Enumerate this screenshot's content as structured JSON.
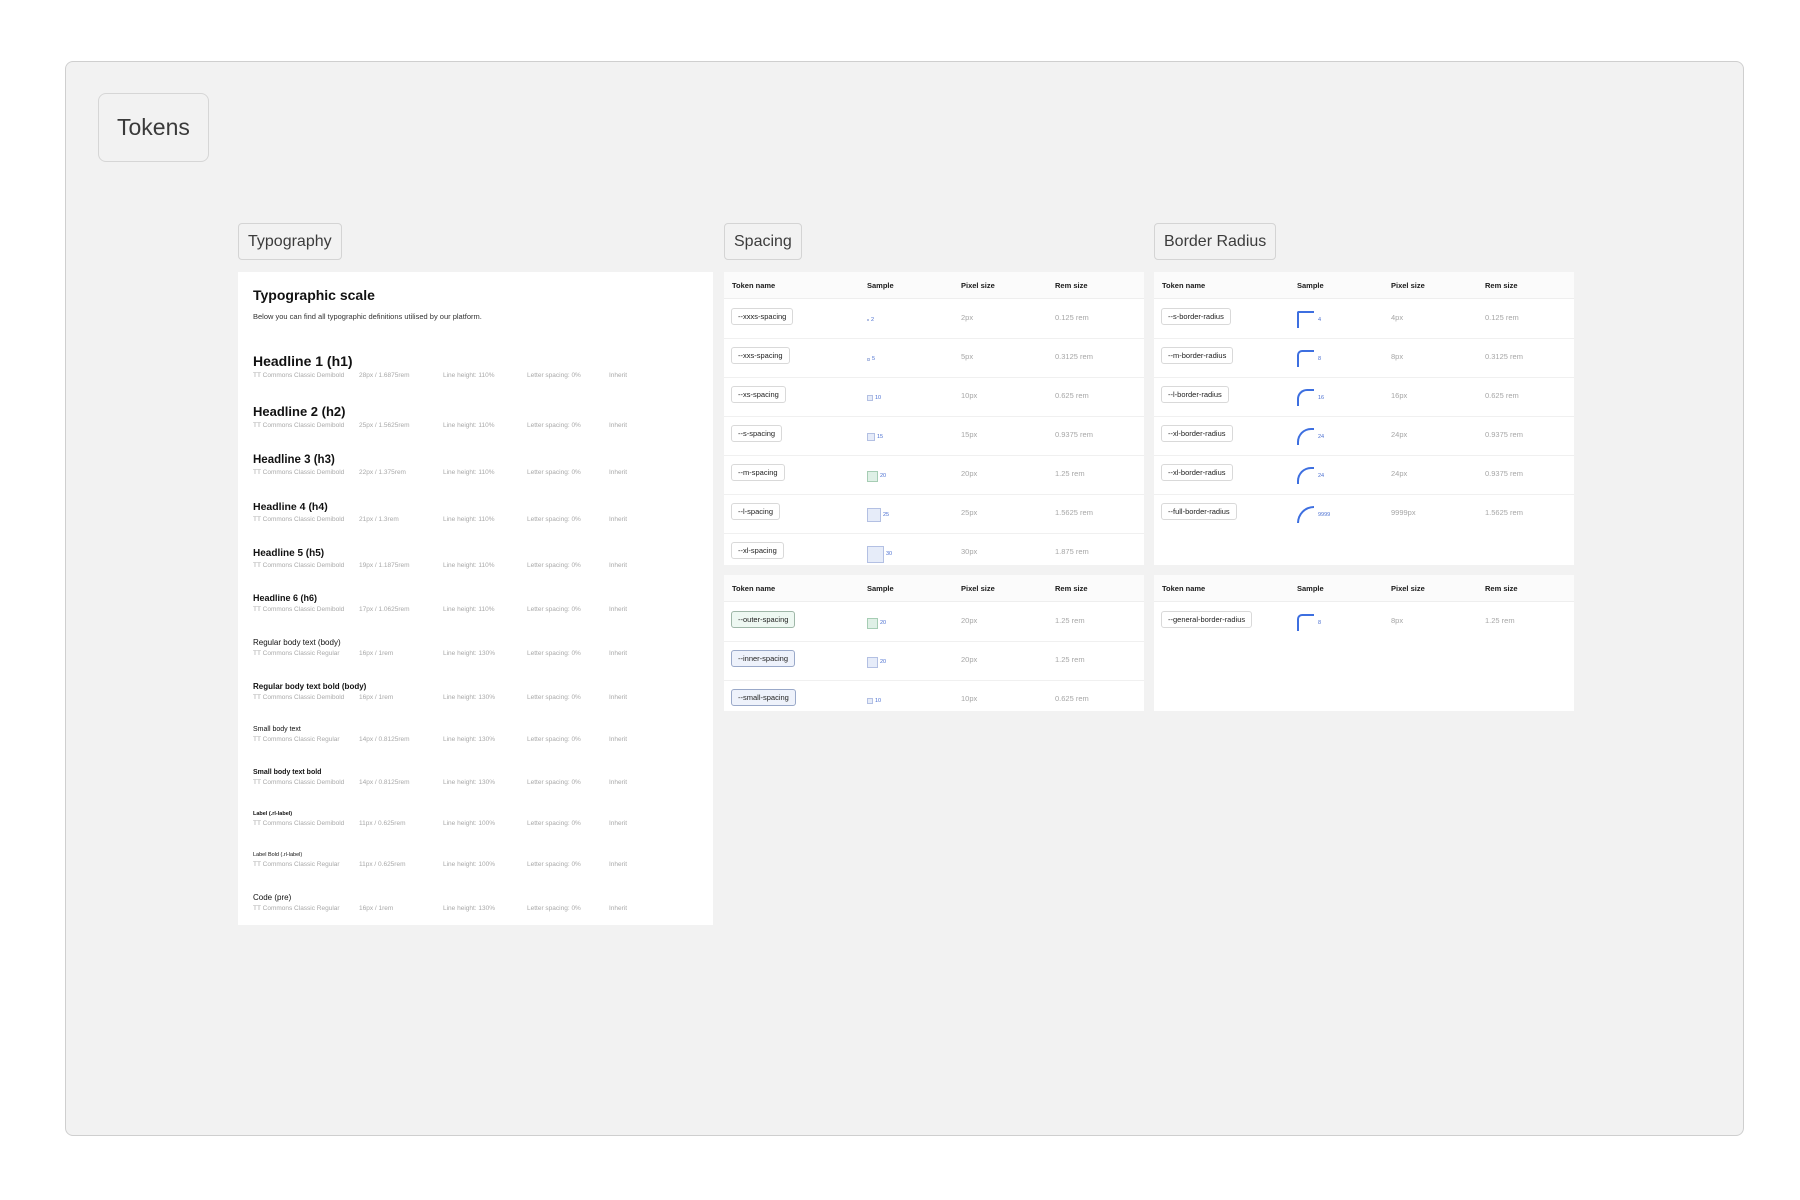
{
  "frame_title": "Tokens",
  "sections": {
    "typography": "Typography",
    "spacing": "Spacing",
    "border_radius": "Border Radius"
  },
  "typography": {
    "heading": "Typographic scale",
    "subheading": "Below you can find all typographic definitions utilised by our platform.",
    "rows": [
      {
        "name": "Headline 1 (h1)",
        "font": "TT Commons Classic Demibold",
        "size": "28px / 1.6875rem",
        "line_height": "Line height: 110%",
        "letter_spacing": "Letter spacing: 0%",
        "case": "Inherit"
      },
      {
        "name": "Headline 2 (h2)",
        "font": "TT Commons Classic Demibold",
        "size": "25px / 1.5625rem",
        "line_height": "Line height: 110%",
        "letter_spacing": "Letter spacing: 0%",
        "case": "Inherit"
      },
      {
        "name": "Headline 3 (h3)",
        "font": "TT Commons Classic Demibold",
        "size": "22px / 1.375rem",
        "line_height": "Line height: 110%",
        "letter_spacing": "Letter spacing: 0%",
        "case": "Inherit"
      },
      {
        "name": "Headline 4 (h4)",
        "font": "TT Commons Classic Demibold",
        "size": "21px / 1.3rem",
        "line_height": "Line height: 110%",
        "letter_spacing": "Letter spacing: 0%",
        "case": "Inherit"
      },
      {
        "name": "Headline 5 (h5)",
        "font": "TT Commons Classic Demibold",
        "size": "19px / 1.1875rem",
        "line_height": "Line height: 110%",
        "letter_spacing": "Letter spacing: 0%",
        "case": "Inherit"
      },
      {
        "name": "Headline 6 (h6)",
        "font": "TT Commons Classic Demibold",
        "size": "17px / 1.0625rem",
        "line_height": "Line height: 110%",
        "letter_spacing": "Letter spacing: 0%",
        "case": "Inherit"
      },
      {
        "name": "Regular body text (body)",
        "font": "TT Commons Classic Regular",
        "size": "16px / 1rem",
        "line_height": "Line height: 130%",
        "letter_spacing": "Letter spacing: 0%",
        "case": "Inherit"
      },
      {
        "name": "Regular body text bold (body)",
        "font": "TT Commons Classic Demibold",
        "size": "16px / 1rem",
        "line_height": "Line height: 130%",
        "letter_spacing": "Letter spacing: 0%",
        "case": "Inherit"
      },
      {
        "name": "Small body text",
        "font": "TT Commons Classic Regular",
        "size": "14px / 0.8125rem",
        "line_height": "Line height: 130%",
        "letter_spacing": "Letter spacing: 0%",
        "case": "Inherit"
      },
      {
        "name": "Small body text bold",
        "font": "TT Commons Classic Demibold",
        "size": "14px / 0.8125rem",
        "line_height": "Line height: 130%",
        "letter_spacing": "Letter spacing: 0%",
        "case": "Inherit"
      },
      {
        "name": "Label (.rl-label)",
        "font": "TT Commons Classic Demibold",
        "size": "11px / 0.625rem",
        "line_height": "Line height: 100%",
        "letter_spacing": "Letter spacing: 0%",
        "case": "Inherit"
      },
      {
        "name": "Label Bold (.rl-label)",
        "font": "TT Commons Classic Regular",
        "size": "11px / 0.625rem",
        "line_height": "Line height: 100%",
        "letter_spacing": "Letter spacing: 0%",
        "case": "Inherit"
      },
      {
        "name": "Code (pre)",
        "font": "TT Commons Classic Regular",
        "size": "16px / 1rem",
        "line_height": "Line height: 130%",
        "letter_spacing": "Letter spacing: 0%",
        "case": "Inherit"
      }
    ]
  },
  "table_headers": {
    "token_name": "Token name",
    "sample": "Sample",
    "pixel_size": "Pixel size",
    "rem_size": "Rem size"
  },
  "spacing": {
    "rows": [
      {
        "token": "--xxxs-spacing",
        "value": 2,
        "label": "2",
        "pixel": "2px",
        "rem": "0.125 rem"
      },
      {
        "token": "--xxs-spacing",
        "value": 5,
        "label": "5",
        "pixel": "5px",
        "rem": "0.3125 rem"
      },
      {
        "token": "--xs-spacing",
        "value": 10,
        "label": "10",
        "pixel": "10px",
        "rem": "0.625 rem"
      },
      {
        "token": "--s-spacing",
        "value": 15,
        "label": "15",
        "pixel": "15px",
        "rem": "0.9375 rem"
      },
      {
        "token": "--m-spacing",
        "value": 20,
        "label": "20",
        "pixel": "20px",
        "rem": "1.25 rem",
        "green": true
      },
      {
        "token": "--l-spacing",
        "value": 25,
        "label": "25",
        "pixel": "25px",
        "rem": "1.5625 rem"
      },
      {
        "token": "--xl-spacing",
        "value": 30,
        "label": "30",
        "pixel": "30px",
        "rem": "1.875 rem"
      }
    ],
    "semantic_rows": [
      {
        "token": "--outer-spacing",
        "value": 20,
        "label": "20",
        "pixel": "20px",
        "rem": "1.25 rem",
        "pill": "green",
        "green": true
      },
      {
        "token": "--inner-spacing",
        "value": 20,
        "label": "20",
        "pixel": "20px",
        "rem": "1.25 rem",
        "pill": "blue"
      },
      {
        "token": "--small-spacing",
        "value": 10,
        "label": "10",
        "pixel": "10px",
        "rem": "0.625 rem",
        "pill": "blue"
      }
    ]
  },
  "border_radius": {
    "rows": [
      {
        "token": "--s-border-radius",
        "value": 4,
        "label": "4",
        "pixel": "4px",
        "rem": "0.125 rem"
      },
      {
        "token": "--m-border-radius",
        "value": 8,
        "label": "8",
        "pixel": "8px",
        "rem": "0.3125 rem"
      },
      {
        "token": "--l-border-radius",
        "value": 16,
        "label": "16",
        "pixel": "16px",
        "rem": "0.625 rem"
      },
      {
        "token": "--xl-border-radius",
        "value": 24,
        "label": "24",
        "pixel": "24px",
        "rem": "0.9375 rem"
      },
      {
        "token": "--xl-border-radius",
        "value": 24,
        "label": "24",
        "pixel": "24px",
        "rem": "0.9375 rem"
      },
      {
        "token": "--full-border-radius",
        "value": 9999,
        "label": "9999",
        "pixel": "9999px",
        "rem": "1.5625 rem"
      }
    ],
    "semantic_rows": [
      {
        "token": "--general-border-radius",
        "value": 8,
        "label": "8",
        "pixel": "8px",
        "rem": "1.25 rem"
      }
    ]
  },
  "colors": {
    "canvas": "#f2f2f2",
    "accent": "#3d6fe0",
    "sample_fill": "#e6ecf9",
    "sample_green": "#dff0e6"
  }
}
